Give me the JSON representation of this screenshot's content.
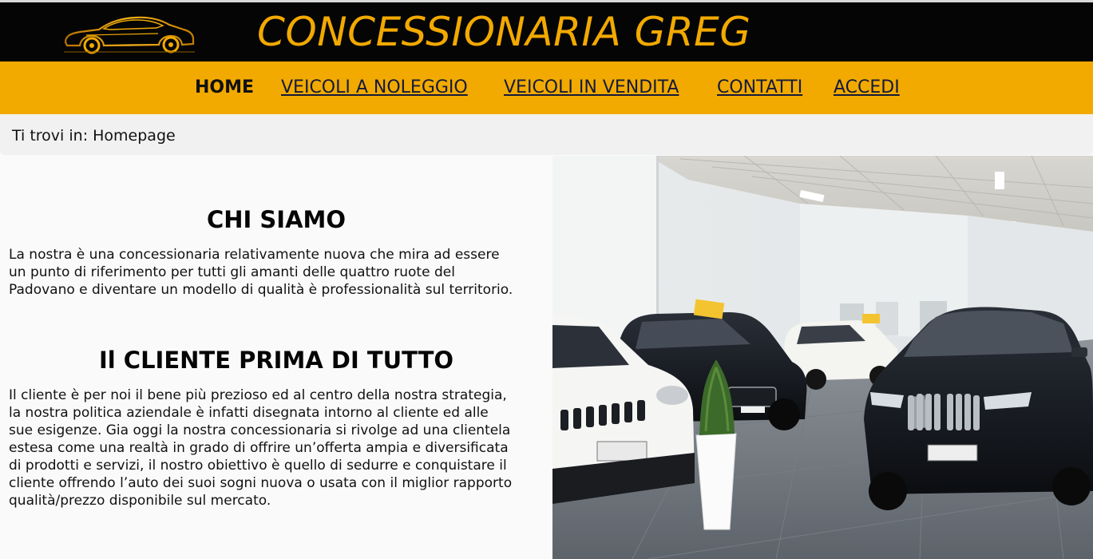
{
  "site": {
    "title": "CONCESSIONARIA GREG",
    "logo_icon": "sports-car-icon"
  },
  "colors": {
    "brand_yellow": "#f2aa00",
    "header_black": "#050505",
    "breadcrumb_bg": "#f1f1f1"
  },
  "nav": {
    "items": [
      {
        "label": "HOME",
        "active": true
      },
      {
        "label": "VEICOLI A NOLEGGIO",
        "active": false
      },
      {
        "label": "VEICOLI IN VENDITA",
        "active": false
      },
      {
        "label": "CONTATTI",
        "active": false
      },
      {
        "label": "ACCEDI",
        "active": false
      }
    ]
  },
  "breadcrumb": {
    "text": "Ti trovi in: Homepage"
  },
  "sections": [
    {
      "title": "CHI SIAMO",
      "lines": [
        "La nostra è una concessionaria relativamente nuova che mira ad essere",
        "un punto di riferimento per tutti gli amanti delle quattro ruote del",
        "Padovano e diventare un modello di qualità è professionalità sul territorio."
      ]
    },
    {
      "title": "Il CLIENTE PRIMA DI TUTTO",
      "lines": [
        "Il cliente è per noi il bene più prezioso ed al centro della nostra strategia,",
        "la nostra politica aziendale è infatti disegnata intorno al cliente ed alle",
        "sue esigenze. Gia oggi la nostra concessionaria si rivolge ad una clientela",
        "estesa come una realtà in grado di offrire un’offerta ampia e diversificata",
        "di prodotti e servizi, il nostro obiettivo è quello di sedurre e conquistare il",
        "cliente offrendo l’auto dei suoi sogni nuova o usata con il miglior rapporto",
        "qualità/prezzo disponibile sul mercato."
      ]
    }
  ],
  "image": {
    "subject": "showroom-photo"
  }
}
